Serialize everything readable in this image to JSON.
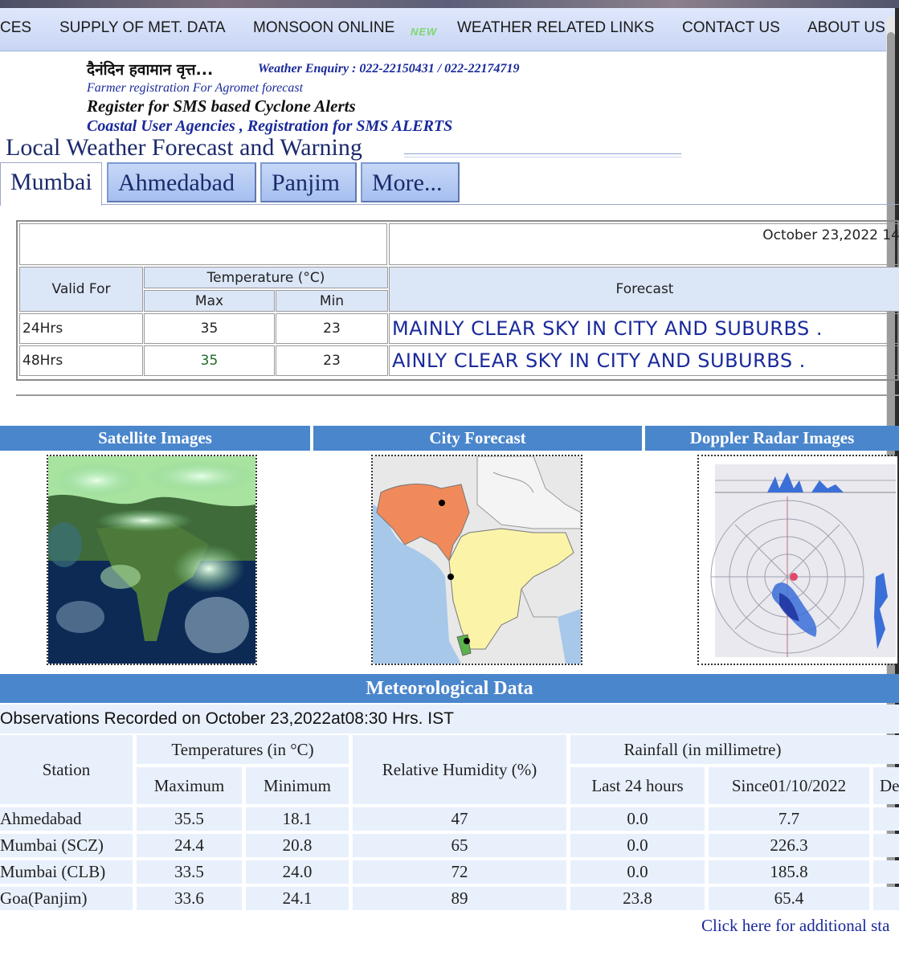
{
  "nav": {
    "items": [
      "CES",
      "SUPPLY OF MET. DATA",
      "MONSOON ONLINE",
      "WEATHER RELATED LINKS",
      "CONTACT US",
      "ABOUT US"
    ],
    "new_badge": "NEW"
  },
  "header": {
    "hindi_title": "दैनंदिन हवामान वृत्त...",
    "enquiry": "Weather Enquiry : 022-22150431 / 022-22174719",
    "farmer_link": "Farmer registration For Agromet forecast",
    "sms_cyclone": "Register for SMS based Cyclone Alerts",
    "coastal_link": "Coastal User Agencies , Registration for SMS ALERTS"
  },
  "section_title": "Local Weather Forecast and Warning",
  "tabs": [
    {
      "label": "Mumbai",
      "active": true
    },
    {
      "label": "Ahmedabad",
      "active": false
    },
    {
      "label": "Panjim",
      "active": false
    },
    {
      "label": "More...",
      "active": false
    }
  ],
  "forecast_table": {
    "date": "October 23,2022 14",
    "valid_for_label": "Valid For",
    "temperature_label": "Temperature (°C)",
    "max_label": "Max",
    "min_label": "Min",
    "forecast_label": "Forecast",
    "rows": [
      {
        "valid": "24Hrs",
        "max": "35",
        "min": "23",
        "forecast": "MAINLY CLEAR SKY IN CITY AND SUBURBS ."
      },
      {
        "valid": "48Hrs",
        "max": "35",
        "min": "23",
        "forecast": "AINLY CLEAR SKY IN CITY AND SUBURBS ."
      }
    ]
  },
  "panels": {
    "satellite": "Satellite Images",
    "city": "City Forecast",
    "doppler": "Doppler Radar Images"
  },
  "meteo": {
    "title": "Meteorological Data",
    "observed": "Observations Recorded on October 23,2022at08:30 Hrs. IST",
    "station_label": "Station",
    "temps_label": "Temperatures (in °C)",
    "max_label": "Maximum",
    "min_label": "Minimum",
    "rh_label": "Relative Humidity (%)",
    "rain_label": "Rainfall (in millimetre)",
    "last24_label": "Last 24 hours",
    "since_label": "Since01/10/2022",
    "dep_label": "De",
    "rows": [
      {
        "station": "Ahmedabad",
        "max": "35.5",
        "min": "18.1",
        "rh": "47",
        "last24": "0.0",
        "since": "7.7"
      },
      {
        "station": "Mumbai (SCZ)",
        "max": "24.4",
        "min": "20.8",
        "rh": "65",
        "last24": "0.0",
        "since": "226.3"
      },
      {
        "station": "Mumbai (CLB)",
        "max": "33.5",
        "min": "24.0",
        "rh": "72",
        "last24": "0.0",
        "since": "185.8"
      },
      {
        "station": "Goa(Panjim)",
        "max": "33.6",
        "min": "24.1",
        "rh": "89",
        "last24": "23.8",
        "since": "65.4"
      }
    ],
    "additional_link": "Click here for additional sta"
  },
  "colors": {
    "nav_bg": "#c9d6f4",
    "bar_blue": "#4a86cc",
    "link_blue": "#1a2a9a",
    "table_bg": "#e8f0fb"
  }
}
